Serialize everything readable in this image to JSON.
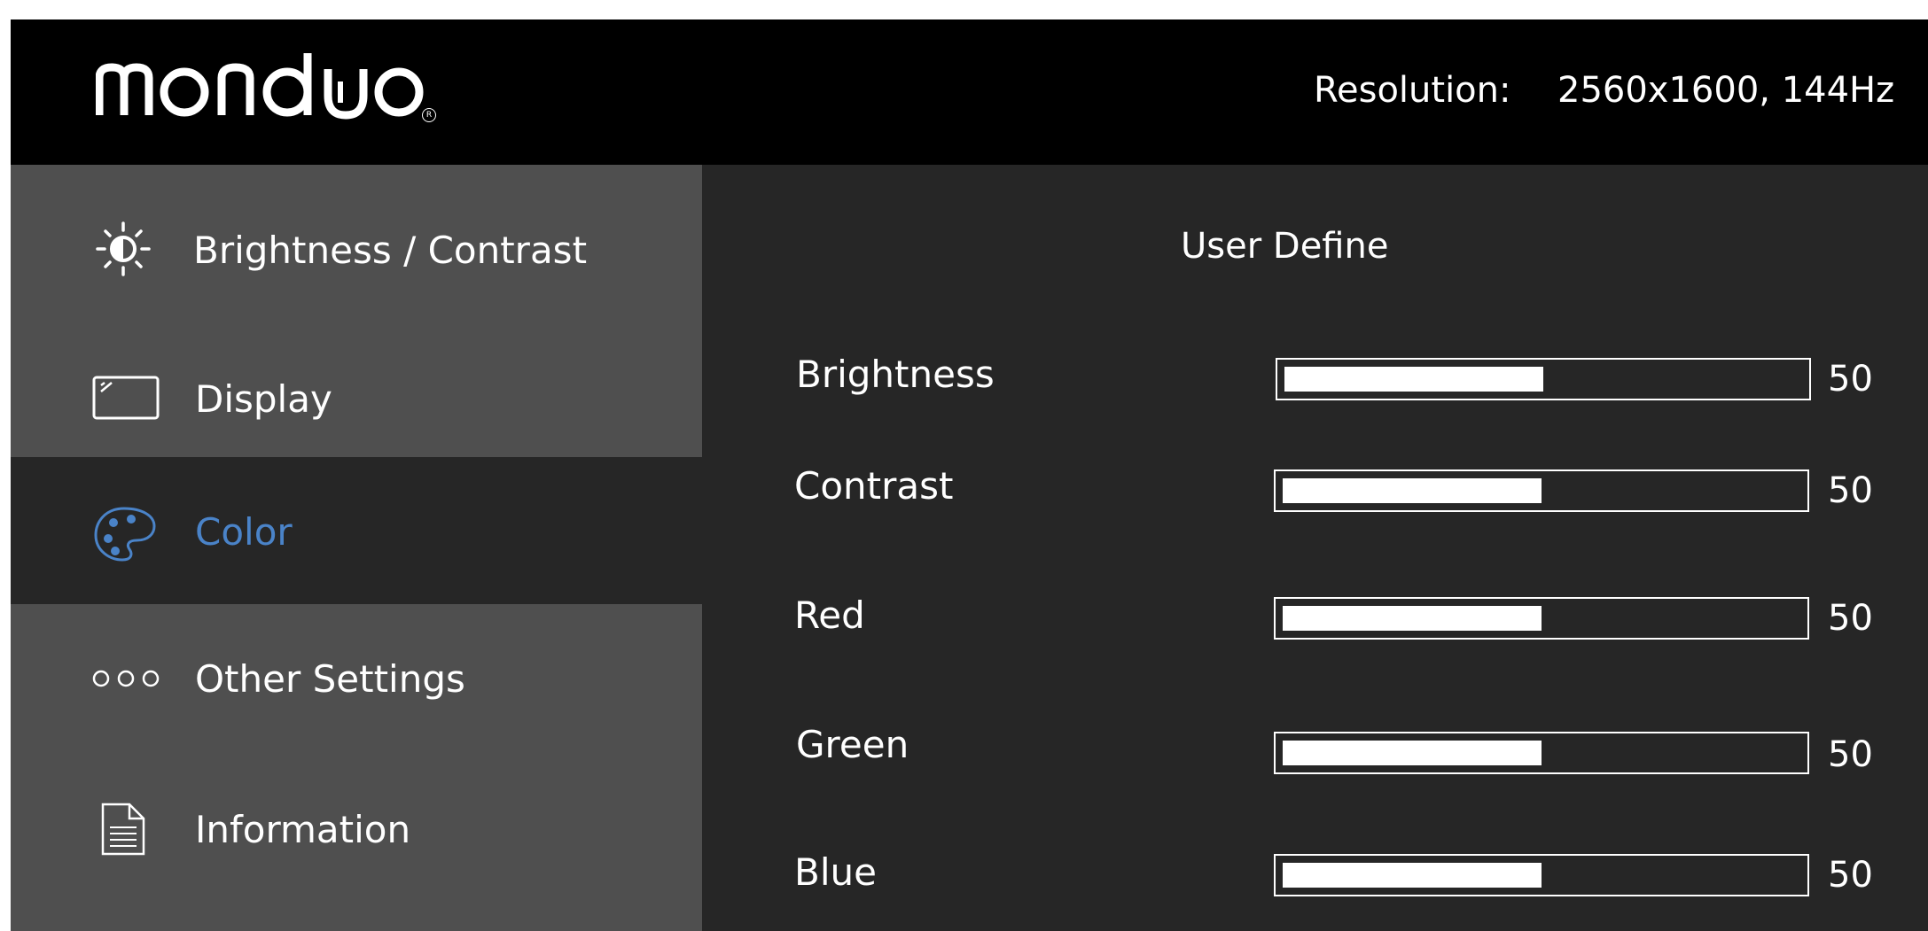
{
  "header": {
    "logo_text": "mondɯo",
    "resolution_label": "Resolution:",
    "resolution_value": "2560x1600, 144Hz"
  },
  "sidebar": {
    "items": [
      {
        "label": "Brightness / Contrast",
        "icon": "sun-icon",
        "active": false
      },
      {
        "label": "Display",
        "icon": "display-icon",
        "active": false
      },
      {
        "label": "Color",
        "icon": "palette-icon",
        "active": true
      },
      {
        "label": "Other Settings",
        "icon": "three-circles-icon",
        "active": false
      },
      {
        "label": "Information",
        "icon": "document-icon",
        "active": false
      }
    ]
  },
  "main": {
    "title": "User Define",
    "settings": [
      {
        "label": "Brightness",
        "value": "50",
        "level": 0.5
      },
      {
        "label": "Contrast",
        "value": "50",
        "level": 0.5
      },
      {
        "label": "Red",
        "value": "50",
        "level": 0.5
      },
      {
        "label": "Green",
        "value": "50",
        "level": 0.5
      },
      {
        "label": "Blue",
        "value": "50",
        "level": 0.5
      }
    ]
  },
  "colors": {
    "background": "#000000",
    "sidebar_item": "#4f4f4f",
    "content_panel": "#262626",
    "accent": "#4a83c8",
    "text": "#ffffff"
  }
}
